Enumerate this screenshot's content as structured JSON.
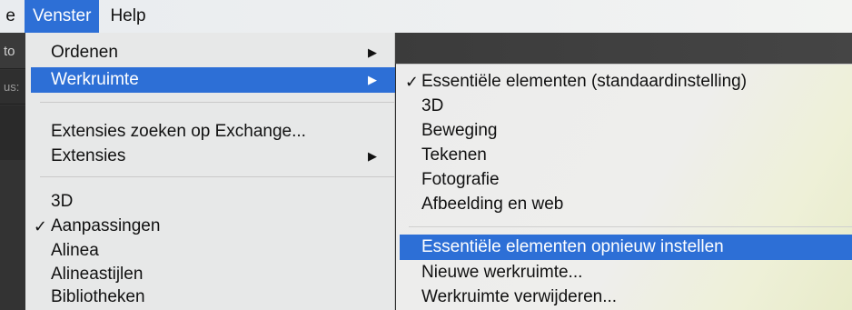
{
  "menubar": {
    "partial_left": "e",
    "active": "Venster",
    "help": "Help"
  },
  "appstrip": {
    "frag1": "to",
    "frag2": "us:"
  },
  "menu": {
    "items": [
      {
        "label": "Ordenen",
        "check": "",
        "arrow": "▶"
      },
      {
        "label": "Werkruimte",
        "check": "",
        "arrow": "▶"
      },
      {
        "label": "Extensies zoeken op Exchange...",
        "check": "",
        "arrow": ""
      },
      {
        "label": "Extensies",
        "check": "",
        "arrow": "▶"
      },
      {
        "label": "3D",
        "check": "",
        "arrow": ""
      },
      {
        "label": "Aanpassingen",
        "check": "✓",
        "arrow": ""
      },
      {
        "label": "Alinea",
        "check": "",
        "arrow": ""
      },
      {
        "label": "Alineastijlen",
        "check": "",
        "arrow": ""
      },
      {
        "label": "Bibliotheken",
        "check": "",
        "arrow": ""
      }
    ]
  },
  "submenu": {
    "items": [
      {
        "label": "Essentiële elementen (standaardinstelling)",
        "check": "✓"
      },
      {
        "label": "3D",
        "check": ""
      },
      {
        "label": "Beweging",
        "check": ""
      },
      {
        "label": "Tekenen",
        "check": ""
      },
      {
        "label": "Fotografie",
        "check": ""
      },
      {
        "label": "Afbeelding en web",
        "check": ""
      },
      {
        "label": "Essentiële elementen opnieuw instellen",
        "check": ""
      },
      {
        "label": "Nieuwe werkruimte...",
        "check": ""
      },
      {
        "label": "Werkruimte verwijderen...",
        "check": ""
      }
    ]
  },
  "colors": {
    "highlight": "#2d6fd6",
    "menu_bg": "#e7e8e8",
    "app_dark": "#333333"
  }
}
